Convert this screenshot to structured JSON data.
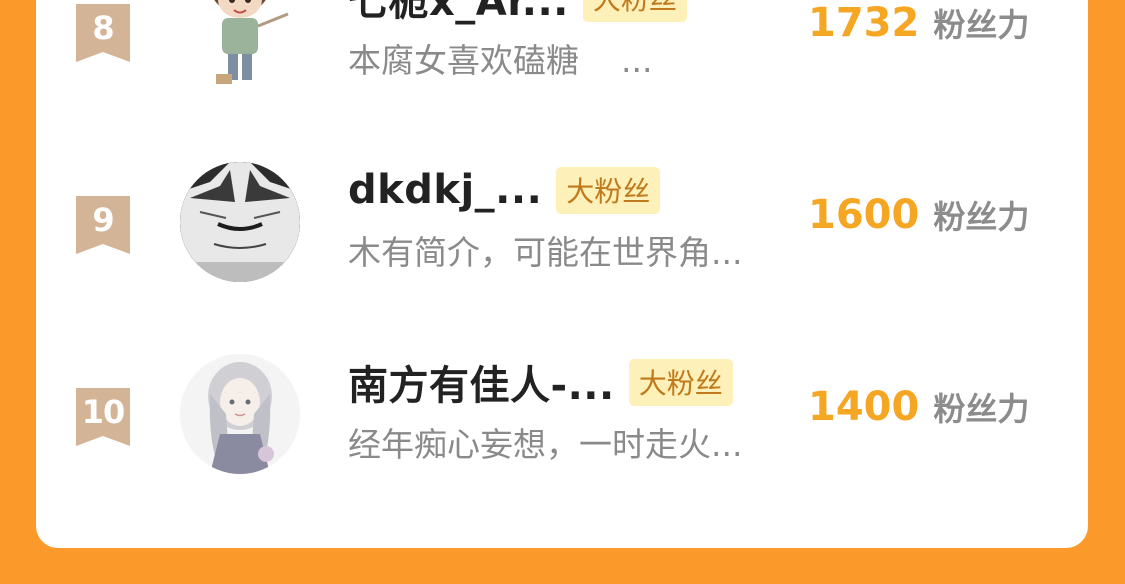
{
  "colors": {
    "background": "#fb9a2b",
    "card": "#ffffff",
    "rank_badge": "#d4b497",
    "score": "#f5a623",
    "tag_bg": "#fdf0b9",
    "tag_text": "#c0791b"
  },
  "ranking": [
    {
      "rank": "8",
      "name": "七栀x_Ar...",
      "tag": "大粉丝",
      "bio": "本腐女喜欢磕糖    ...",
      "score": "1732",
      "unit": "粉丝力"
    },
    {
      "rank": "9",
      "name": "dkdkj_...",
      "tag": "大粉丝",
      "bio": "木有简介，可能在世界角...",
      "score": "1600",
      "unit": "粉丝力"
    },
    {
      "rank": "10",
      "name": "南方有佳人-...",
      "tag": "大粉丝",
      "bio": "经年痴心妄想，一时走火...",
      "score": "1400",
      "unit": "粉丝力"
    }
  ]
}
